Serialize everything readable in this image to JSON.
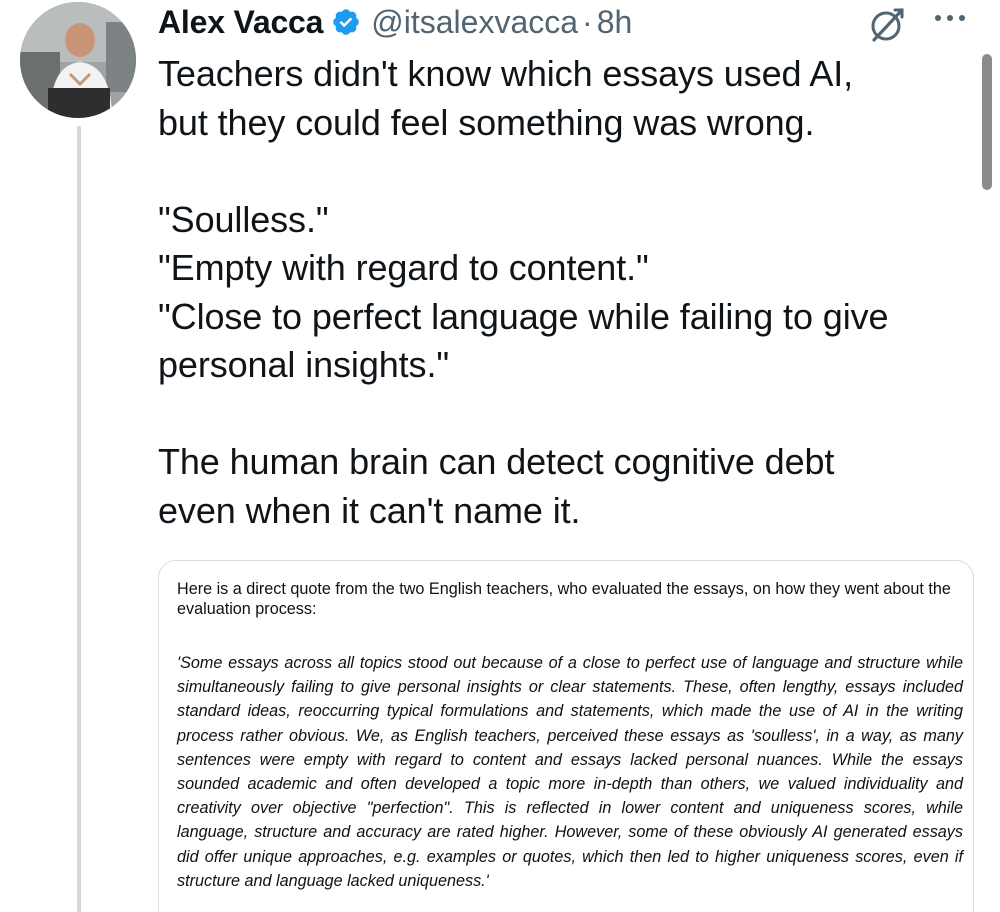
{
  "tweet": {
    "display_name": "Alex Vacca",
    "handle": "@itsalexvacca",
    "separator": "·",
    "time": "8h",
    "text": "Teachers didn't know which essays used AI,\nbut they could feel something was wrong.\n\n\"Soulless.\"\n\"Empty with regard to content.\"\n\"Close to perfect language while failing to give\npersonal insights.\"\n\nThe human brain can detect cognitive debt\neven when it can't name it."
  },
  "quoted_image": {
    "intro": "Here is a direct quote from the two English teachers, who evaluated the essays, on how they went about the evaluation process:",
    "quote": "'Some essays across all topics stood out because of a close to perfect use of language and structure while simultaneously failing to give personal insights or clear statements. These, often lengthy, essays included standard ideas, reoccurring typical formulations and statements, which made the use of AI in the writing process rather obvious. We, as English teachers, perceived these essays as 'soulless', in a way, as many sentences were empty with regard to content and essays lacked personal nuances. While the essays sounded academic and often developed a topic more in-depth than others, we valued individuality and creativity over objective \"perfection\". This is reflected in lower content and uniqueness scores, while language, structure and accuracy are rated higher. However, some of these obviously AI generated essays did offer unique approaches, e.g. examples or quotes, which then led to higher uniqueness scores, even if structure and language lacked uniqueness.'"
  },
  "icons": {
    "verified": "verified-badge-icon",
    "grok": "grok-icon",
    "more": "more-options-icon"
  },
  "colors": {
    "verified_blue": "#1d9bf0",
    "secondary_text": "#536471",
    "thread_line": "#cfd9de"
  }
}
